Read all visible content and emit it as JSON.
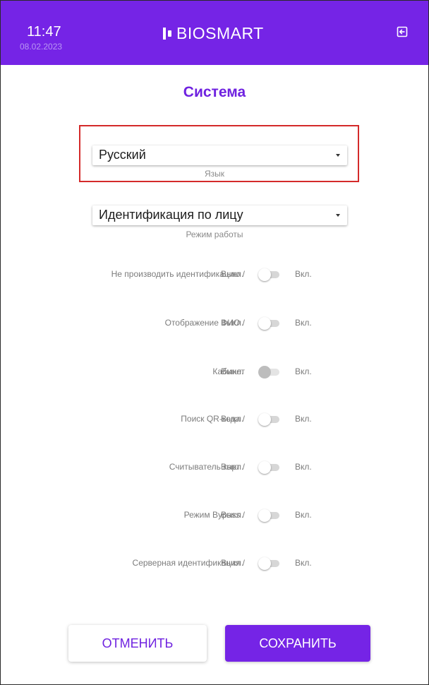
{
  "header": {
    "time": "11:47",
    "date": "08.02.2023",
    "logo_text": "BIOSMART",
    "exit_icon": "logout-icon",
    "background_color": "#7524e6"
  },
  "page": {
    "title": "Система",
    "accent_color": "#6f22e0"
  },
  "language": {
    "value": "Русский",
    "caption": "Язык",
    "highlighted": true
  },
  "mode": {
    "value": "Идентификация по лицу",
    "caption": "Режим работы"
  },
  "toggles": [
    {
      "label": "Не производить идентификацию /",
      "off_label": "Выкл.",
      "on_label": "Вкл.",
      "enabled": false,
      "disabled": false
    },
    {
      "label": "Отображение ФИО /",
      "off_label": "Выкл.",
      "on_label": "Вкл.",
      "enabled": false,
      "disabled": false
    },
    {
      "label": "Кабинет",
      "off_label": "Выкл.",
      "on_label": "Вкл.",
      "enabled": false,
      "disabled": true
    },
    {
      "label": "Поиск QR-кода /",
      "off_label": "Выкл.",
      "on_label": "Вкл.",
      "enabled": false,
      "disabled": false
    },
    {
      "label": "Считыватель карт /",
      "off_label": "Выкл.",
      "on_label": "Вкл.",
      "enabled": false,
      "disabled": false
    },
    {
      "label": "Режим Bypass /",
      "off_label": "Выкл.",
      "on_label": "Вкл.",
      "enabled": false,
      "disabled": false
    },
    {
      "label": "Серверная идентификация /",
      "off_label": "Выкл.",
      "on_label": "Вкл.",
      "enabled": false,
      "disabled": false
    }
  ],
  "actions": {
    "cancel_label": "ОТМЕНИТЬ",
    "save_label": "СОХРАНИТЬ"
  }
}
